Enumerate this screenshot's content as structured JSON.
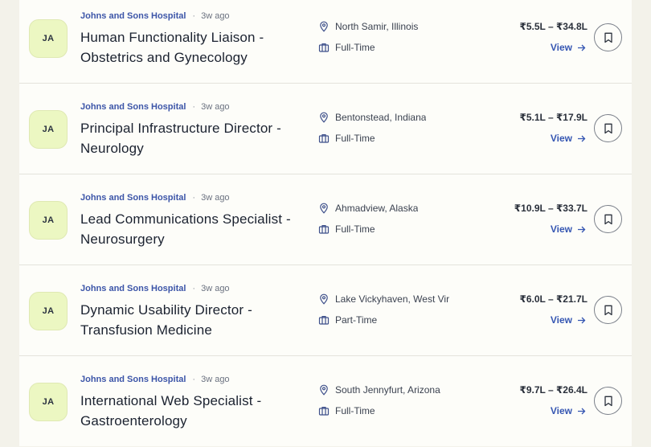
{
  "jobs": [
    {
      "initials": "JA",
      "company": "Johns and Sons Hospital",
      "separator": "·",
      "posted": "3w ago",
      "title": "Human Functionality Liaison - Obstetrics and Gynecology",
      "location": "North Samir, Illinois",
      "employment_type": "Full-Time",
      "salary": "₹5.5L – ₹34.8L",
      "view_label": "View"
    },
    {
      "initials": "JA",
      "company": "Johns and Sons Hospital",
      "separator": "·",
      "posted": "3w ago",
      "title": "Principal Infrastructure Director - Neurology",
      "location": "Bentonstead, Indiana",
      "employment_type": "Full-Time",
      "salary": "₹5.1L – ₹17.9L",
      "view_label": "View"
    },
    {
      "initials": "JA",
      "company": "Johns and Sons Hospital",
      "separator": "·",
      "posted": "3w ago",
      "title": "Lead Communications Specialist - Neurosurgery",
      "location": "Ahmadview, Alaska",
      "employment_type": "Full-Time",
      "salary": "₹10.9L – ₹33.7L",
      "view_label": "View"
    },
    {
      "initials": "JA",
      "company": "Johns and Sons Hospital",
      "separator": "·",
      "posted": "3w ago",
      "title": "Dynamic Usability Director - Transfusion Medicine",
      "location": "Lake Vickyhaven, West Vir",
      "employment_type": "Part-Time",
      "salary": "₹6.0L – ₹21.7L",
      "view_label": "View"
    },
    {
      "initials": "JA",
      "company": "Johns and Sons Hospital",
      "separator": "·",
      "posted": "3w ago",
      "title": "International Web Specialist - Gastroenterology",
      "location": "South Jennyfurt, Arizona",
      "employment_type": "Full-Time",
      "salary": "₹9.7L – ₹26.4L",
      "view_label": "View"
    }
  ],
  "icons": {
    "location": "map-pin-icon",
    "employment_type": "briefcase-icon",
    "view": "arrow-right-icon",
    "save": "bookmark-icon"
  },
  "colors": {
    "company": "#3c55a8",
    "view_link": "#3556b2",
    "avatar_bg": "#ecf7c2",
    "page_bg": "#f3f2ea",
    "card_bg": "#fdfdf9"
  }
}
